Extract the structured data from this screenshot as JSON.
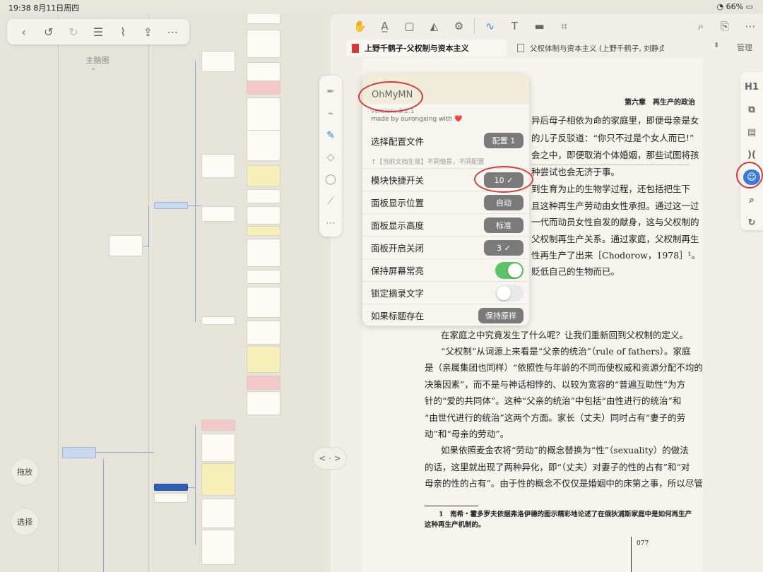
{
  "status": {
    "time": "19:38",
    "date": "8月11日周四",
    "battery": "66%"
  },
  "left_toolbar": {
    "icons": [
      "back-icon",
      "undo-icon",
      "redo-icon",
      "list-icon",
      "mindmap-icon",
      "share-icon",
      "more-icon"
    ]
  },
  "mindmap": {
    "label": "主脑图",
    "drag_button": "拖放",
    "select_button": "选择"
  },
  "palette": {
    "icons": [
      "pen-icon",
      "highlighter-icon",
      "marker-icon",
      "eraser-icon",
      "lasso-icon",
      "ruler-icon",
      "more-icon"
    ]
  },
  "split_handle": "< · >",
  "topbar": {
    "icons": [
      "hand-icon",
      "text-highlight-icon",
      "rect-select-icon",
      "image-icon",
      "shape-icon",
      "handwriting-icon",
      "textbox-icon",
      "media-icon",
      "ocr-icon",
      "search-icon",
      "bookmark-icon",
      "more-icon"
    ]
  },
  "tabs": {
    "active": "上野千鹤子-父权制与资本主义",
    "other": "父权体制与资本主义 (上野千鹤子, 刘静贞,..."
  },
  "manage_label": "管理",
  "document": {
    "running_head": "第六章　再生产的政治",
    "lines_right": [
      "异后母子相依为命的家庭里，即便母亲是女",
      "的儿子反驳道：“你只不过是个女人而已!”",
      "会之中，即便取消个体婚姻，那些试图将孩",
      "种尝试也会无济于事。",
      "到生育为止的生物学过程，还包括把生下",
      "且这种再生产劳动由女性承担。通过这一过",
      "一代而动员女性自发的献身，这与父权制的",
      "父权制再生产关系。通过家庭，父权制再生",
      "性再生产了出来［Chodorow，1978］¹。",
      "贬低自己的生物而已。"
    ],
    "paragraphs": [
      "在家庭之中究竟发生了什么呢？让我们重新回到父权制的定义。",
      "“父权制”从词源上来看是“父亲的统治”（rule of fathers）。家庭",
      "是（亲属集团也同样）“依照性与年龄的不同而使权威和资源分配不均的",
      "决策因素”，而不是与神话相悖的、以较为宽容的“普遍互助性”为方",
      "针的“爱的共同体”。这种“父亲的统治”中包括“由性进行的统治”和",
      "“由世代进行的统治”这两个方面。家长（丈夫）同时占有“妻子的劳",
      "动”和“母亲的劳动”。",
      "如果依照麦金农将“劳动”的概念替换为“性”（sexuality）的做法",
      "的话，这里就出现了两种异化，即“（丈夫）对妻子的性的占有”和“对",
      "母亲的性的占有”。由于性的概念不仅仅是婚姻中的床第之事，所以尽管"
    ],
    "footnote_1": "1　南希・霍多罗夫依据弗洛伊德的图示精彩地论述了在俄狄浦斯家庭中是如何再生产",
    "footnote_2": "这种再生产机制的。",
    "page_number": "077"
  },
  "sidebar": {
    "labels": [
      "H1",
      "",
      "",
      "",
      "",
      "",
      ""
    ]
  },
  "panel": {
    "title": "OhMyMN",
    "version": "version: 3.2.1",
    "author": "made by ourongxing with ❤️",
    "rows": [
      {
        "label": "选择配置文件",
        "value": "配置 1"
      },
      {
        "label": "模块快捷开关",
        "value": "10 ✓"
      },
      {
        "label": "面板显示位置",
        "value": "自动"
      },
      {
        "label": "面板显示高度",
        "value": "标准"
      },
      {
        "label": "面板开启关闭",
        "value": "3 ✓"
      },
      {
        "label": "保持屏幕常亮",
        "value": ""
      },
      {
        "label": "锁定摘录文字",
        "value": ""
      },
      {
        "label": "如果标题存在",
        "value": "保持原样"
      }
    ],
    "hint": "↑【当前文档生效】不同情景，不同配置",
    "toggles": {
      "keep_screen_on": true,
      "lock_excerpt": false
    }
  },
  "colors": {
    "accent": "#3b7bd6",
    "annotation_red": "#d23b3b",
    "toggle_on": "#5bc466"
  }
}
